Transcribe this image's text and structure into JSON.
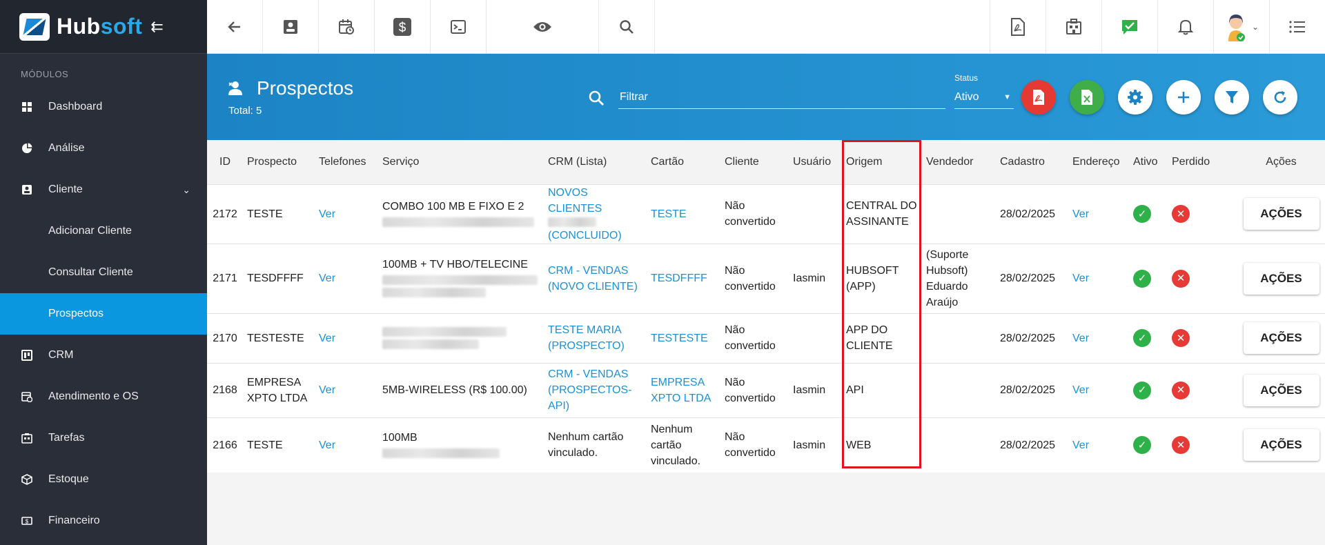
{
  "brand": {
    "hub": "Hub",
    "soft": "soft"
  },
  "sidebar": {
    "section_label": "MÓDULOS",
    "items": [
      {
        "label": "Dashboard",
        "icon": "dashboard-icon"
      },
      {
        "label": "Análise",
        "icon": "pie-chart-icon"
      },
      {
        "label": "Cliente",
        "icon": "client-card-icon"
      },
      {
        "label": "Adicionar Cliente"
      },
      {
        "label": "Consultar Cliente"
      },
      {
        "label": "Prospectos"
      },
      {
        "label": "CRM",
        "icon": "crm-board-icon"
      },
      {
        "label": "Atendimento e OS",
        "icon": "calendar-clock-icon"
      },
      {
        "label": "Tarefas",
        "icon": "tasks-icon"
      },
      {
        "label": "Estoque",
        "icon": "box-icon"
      },
      {
        "label": "Financeiro",
        "icon": "money-icon"
      }
    ]
  },
  "header": {
    "title": "Prospectos",
    "total": "Total: 5",
    "filter_placeholder": "Filtrar",
    "status_label": "Status",
    "status_value": "Ativo"
  },
  "colors": {
    "accent": "#0a97e0",
    "sidebar": "#2a2e38",
    "band": "#1c84c4",
    "highlight": "#e4121a"
  },
  "table": {
    "columns": [
      "ID",
      "Prospecto",
      "Telefones",
      "Serviço",
      "CRM (Lista)",
      "Cartão",
      "Cliente",
      "Usuário",
      "Origem",
      "Vendedor",
      "Cadastro",
      "Endereço",
      "Ativo",
      "Perdido",
      "Ações"
    ],
    "rows": [
      {
        "id": "2172",
        "prospecto": "TESTE",
        "telefones": "Ver",
        "servico": "COMBO 100 MB E FIXO E 2",
        "crm_a": "NOVOS CLIENTES",
        "crm_b": "(CONCLUIDO)",
        "cartao": "TESTE",
        "cliente_a": "Não",
        "cliente_b": "convertido",
        "usuario": "",
        "origem_a": "CENTRAL DO",
        "origem_b": "ASSINANTE",
        "vendedor": "",
        "cadastro": "28/02/2025",
        "endereco": "Ver",
        "acoes": "AÇÕES"
      },
      {
        "id": "2171",
        "prospecto": "TESDFFFF",
        "telefones": "Ver",
        "servico": "100MB + TV HBO/TELECINE",
        "crm_a": "CRM - VENDAS",
        "crm_b": "(NOVO CLIENTE)",
        "cartao": "TESDFFFF",
        "cliente_a": "Não",
        "cliente_b": "convertido",
        "usuario": "Iasmin",
        "origem_a": "HUBSOFT",
        "origem_b": "(APP)",
        "vendedor_lines": [
          "(Suporte",
          "Hubsoft)",
          "Eduardo",
          "Araújo"
        ],
        "cadastro": "28/02/2025",
        "endereco": "Ver",
        "acoes": "AÇÕES"
      },
      {
        "id": "2170",
        "prospecto": "TESTESTE",
        "telefones": "Ver",
        "servico": "",
        "crm_a": "TESTE MARIA",
        "crm_b": "(PROSPECTO)",
        "cartao": "TESTESTE",
        "cliente_a": "Não",
        "cliente_b": "convertido",
        "usuario": "",
        "origem_a": "APP DO",
        "origem_b": "CLIENTE",
        "vendedor": "",
        "cadastro": "28/02/2025",
        "endereco": "Ver",
        "acoes": "AÇÕES"
      },
      {
        "id": "2168",
        "prospecto_a": "EMPRESA",
        "prospecto_b": "XPTO LTDA",
        "telefones": "Ver",
        "servico": "5MB-WIRELESS (R$ 100.00)",
        "crm_lines": [
          "CRM - VENDAS",
          "(PROSPECTOS-",
          "API)"
        ],
        "cartao_a": "EMPRESA",
        "cartao_b": "XPTO LTDA",
        "cliente_a": "Não",
        "cliente_b": "convertido",
        "usuario": "Iasmin",
        "origem": "API",
        "vendedor": "",
        "cadastro": "28/02/2025",
        "endereco": "Ver",
        "acoes": "AÇÕES"
      },
      {
        "id": "2166",
        "prospecto": "TESTE",
        "telefones": "Ver",
        "servico": "100MB",
        "crm_a": "Nenhum cartão",
        "crm_b": "vinculado.",
        "cartao_lines": [
          "Nenhum",
          "cartão",
          "vinculado."
        ],
        "cliente_a": "Não",
        "cliente_b": "convertido",
        "usuario": "Iasmin",
        "origem": "WEB",
        "vendedor": "",
        "cadastro": "28/02/2025",
        "endereco": "Ver",
        "acoes": "AÇÕES"
      }
    ]
  }
}
